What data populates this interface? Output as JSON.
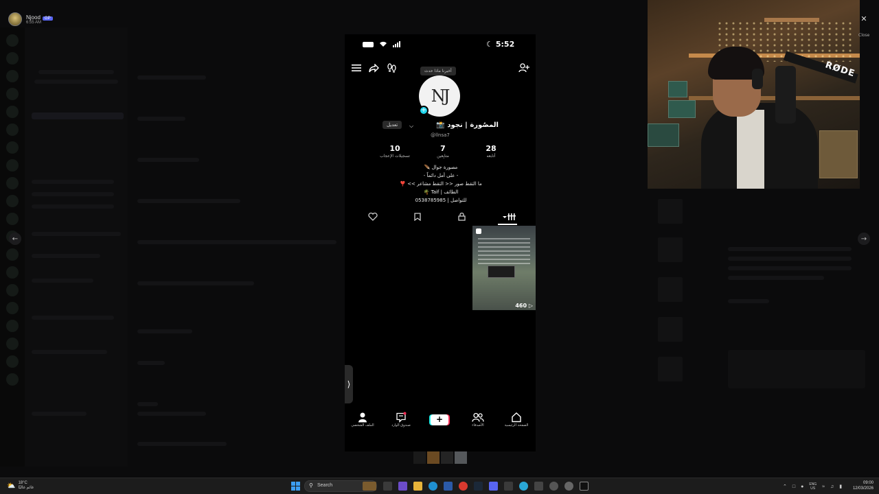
{
  "background_app": {
    "user_name": "Njood",
    "user_badge": "GP",
    "user_time": "6:55 AM"
  },
  "phone": {
    "status_time": "5:52",
    "tooltip": "أخبرنا ماذا حدث",
    "avatar_monogram": "NJ",
    "edit_button": "تعديل",
    "display_name": "المصُورة | نجود 📸",
    "handle": "@llnsa7",
    "stats": [
      {
        "value": "28",
        "label": "أتابعه"
      },
      {
        "value": "7",
        "label": "متابِعين"
      },
      {
        "value": "10",
        "label": "تسجيلات الإعجاب"
      }
    ],
    "bio": [
      "مصورة جوال 🪶",
      "- على أمل دائماً -",
      "ما التقط صور << التقط مشاعر >> ❣️",
      "الطائف | Taif 🌴",
      "للتواصل | 0538785985"
    ],
    "video": {
      "views": "460"
    },
    "bottom_nav": [
      {
        "label": "الصفحة الرئيسية",
        "icon": "home-icon"
      },
      {
        "label": "الأصدقاء",
        "icon": "friends-icon"
      },
      {
        "label": "",
        "icon": "create-plus-icon"
      },
      {
        "label": "صندوق الوارد",
        "icon": "inbox-icon"
      },
      {
        "label": "الملف الشخصي",
        "icon": "profile-icon"
      }
    ]
  },
  "webcam": {
    "mic_brand": "RØDE"
  },
  "overlay": {
    "close_label": "Close"
  },
  "taskbar": {
    "weather_temp": "18°C",
    "weather_desc": "غائم غالبًا",
    "search_placeholder": "Search",
    "lang_line1": "ENG",
    "lang_line2": "US",
    "clock_time": "09:00",
    "clock_date": "12/03/2026"
  },
  "colors": {
    "accent_cyan": "#20d5ec",
    "accent_red": "#fe2c55",
    "taskbar_bg": "#1c1c1c"
  }
}
